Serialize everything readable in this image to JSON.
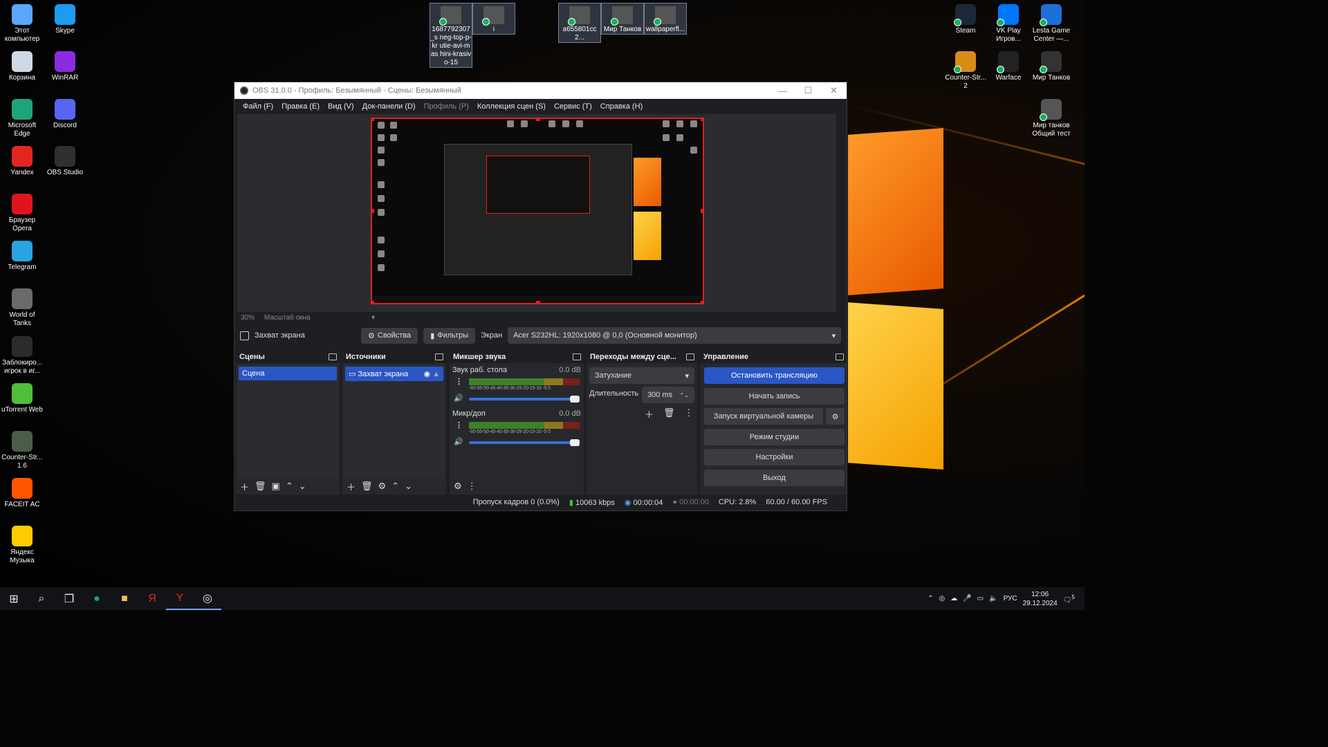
{
  "desktop": {
    "left_icons": [
      {
        "label": "Этот компьютер",
        "color": "#5aa6ff"
      },
      {
        "label": "Skype",
        "color": "#1d9bf0"
      },
      {
        "label": "Корзина",
        "color": "#cfd8e3"
      },
      {
        "label": "WinRAR",
        "color": "#8a2be2"
      },
      {
        "label": "Microsoft Edge",
        "color": "#1fa37a"
      },
      {
        "label": "Discord",
        "color": "#5865f2"
      },
      {
        "label": "Yandex",
        "color": "#e52620"
      },
      {
        "label": "OBS Studio",
        "color": "#303030"
      },
      {
        "label": "Браузер Opera",
        "color": "#e0141e"
      },
      {
        "label": "Telegram",
        "color": "#2aa3e0"
      },
      {
        "label": "World of Tanks",
        "color": "#6a6a6a"
      },
      {
        "label": "Заблокиро... игрок в иг...",
        "color": "#2b2b2b"
      },
      {
        "label": "uTorrent Web",
        "color": "#4fbf3a"
      },
      {
        "label": "Counter-Str... 1.6",
        "color": "#4d5b4a"
      },
      {
        "label": "FACEIT AC",
        "color": "#ff5500"
      },
      {
        "label": "Яндекс Музыка",
        "color": "#ffcc00"
      }
    ],
    "top_files": [
      {
        "label": "1687792307_s neg-top-p-kr utie-avi-mas hini-krasivo-15"
      },
      {
        "label": "i"
      },
      {
        "label": "a655801cc2..."
      },
      {
        "label": "Мир Танков"
      },
      {
        "label": "wallpaperfl..."
      }
    ],
    "right_icons": [
      {
        "label": "Steam",
        "color": "#1b2838"
      },
      {
        "label": "VK Play Игров...",
        "color": "#0077ff"
      },
      {
        "label": "Lesta Game Center —...",
        "color": "#1e6fd9"
      },
      {
        "label": "Counter-Str... 2",
        "color": "#d98b1a"
      },
      {
        "label": "Warface",
        "color": "#222"
      },
      {
        "label": "Мир Танков",
        "color": "#333"
      },
      {
        "label": "Мир танков Общий тест",
        "color": "#555"
      }
    ]
  },
  "obs": {
    "title": "OBS 31.0.0 - Профиль: Безымянный - Сцены: Безымянный",
    "menu": [
      "Файл (F)",
      "Правка (E)",
      "Вид (V)",
      "Док-панели (D)",
      "Профиль (P)",
      "Коллекция сцен (S)",
      "Сервис (T)",
      "Справка (H)"
    ],
    "zoom": {
      "percent": "30%",
      "scale_label": "Масштаб окна"
    },
    "source_bar": {
      "source_name": "Захват экрана",
      "properties": "Свойства",
      "filters": "Фильтры",
      "screen_label": "Экран",
      "screen_value": "Acer S232HL: 1920x1080 @ 0,0 (Основной монитор)"
    },
    "scenes": {
      "title": "Сцены",
      "items": [
        "Сцена"
      ]
    },
    "sources": {
      "title": "Источники",
      "items": [
        "Захват экрана"
      ]
    },
    "mixer": {
      "title": "Микшер звука",
      "channels": [
        {
          "name": "Звук раб. стола",
          "db": "0.0 dB"
        },
        {
          "name": "Микр/доп",
          "db": "0.0 dB"
        }
      ],
      "scale": "-60-55-50-45-40-35-30-25-20-15-10 -5  0"
    },
    "transitions": {
      "title": "Переходы между сце...",
      "type": "Затухание",
      "duration_label": "Длительность",
      "duration_value": "300 ms"
    },
    "controls": {
      "title": "Управление",
      "buttons": [
        "Остановить трансляцию",
        "Начать запись",
        "Запуск виртуальной камеры",
        "Режим студии",
        "Настройки",
        "Выход"
      ]
    },
    "status": {
      "dropped": "Пропуск кадров 0 (0.0%)",
      "bitrate": "10063 kbps",
      "stream_time": "00:00:04",
      "rec_time": "00:00:00",
      "cpu": "CPU: 2.8%",
      "fps": "60.00 / 60.00 FPS"
    }
  },
  "taskbar": {
    "lang": "РУС",
    "time": "12:06",
    "date": "29.12.2024",
    "notifications": "5"
  }
}
